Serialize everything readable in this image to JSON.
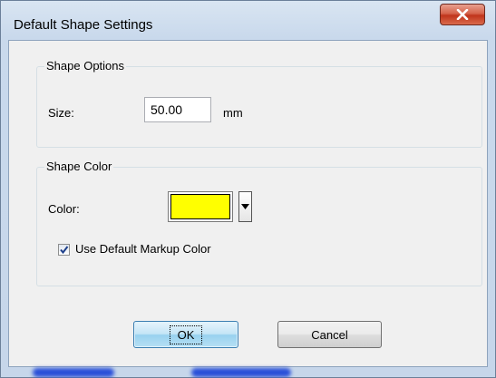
{
  "window": {
    "title": "Default Shape Settings"
  },
  "shape_options": {
    "legend": "Shape Options",
    "size_label": "Size:",
    "size_value": "50.00",
    "size_unit": "mm"
  },
  "shape_color": {
    "legend": "Shape Color",
    "color_label": "Color:",
    "color_value": "#ffff00",
    "use_default_label": "Use Default Markup Color",
    "use_default_checked": true
  },
  "buttons": {
    "ok_label": "OK",
    "cancel_label": "Cancel"
  },
  "icons": {
    "close": "close-icon",
    "dropdown": "chevron-down-icon",
    "check": "checkmark-icon"
  }
}
